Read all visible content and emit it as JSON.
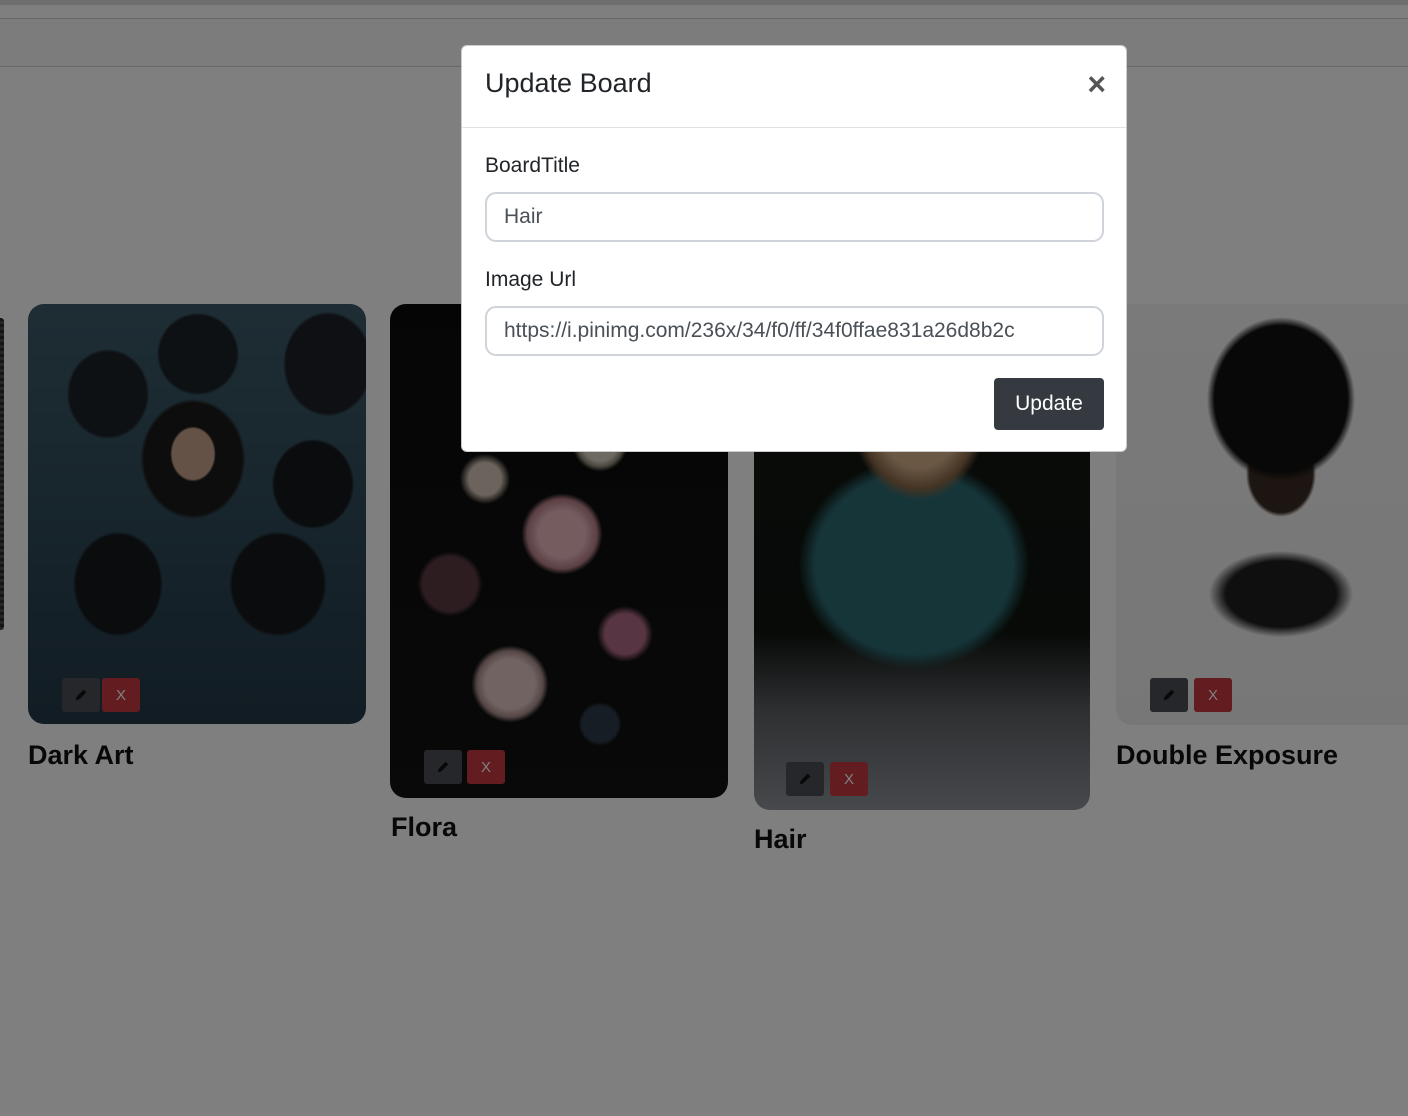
{
  "modal": {
    "title": "Update Board",
    "close_label": "×",
    "board_title_label": "BoardTitle",
    "board_title_value": "Hair",
    "image_url_label": "Image Url",
    "image_url_value": "https://i.pinimg.com/236x/34/f0/ff/34f0ffae831a26d8b2c",
    "submit_label": "Update"
  },
  "boards": [
    {
      "title": "Dark Art",
      "edit_icon": "pencil-icon",
      "delete_label": "X"
    },
    {
      "title": "Flora",
      "edit_icon": "pencil-icon",
      "delete_label": "X"
    },
    {
      "title": "Hair",
      "edit_icon": "pencil-icon",
      "delete_label": "X"
    },
    {
      "title": "Double Exposure",
      "edit_icon": "pencil-icon",
      "delete_label": "X"
    }
  ],
  "colors": {
    "backdrop": "#000000",
    "edit_button": "#4a4f55",
    "delete_button": "#c63940",
    "update_button": "#343a40"
  }
}
